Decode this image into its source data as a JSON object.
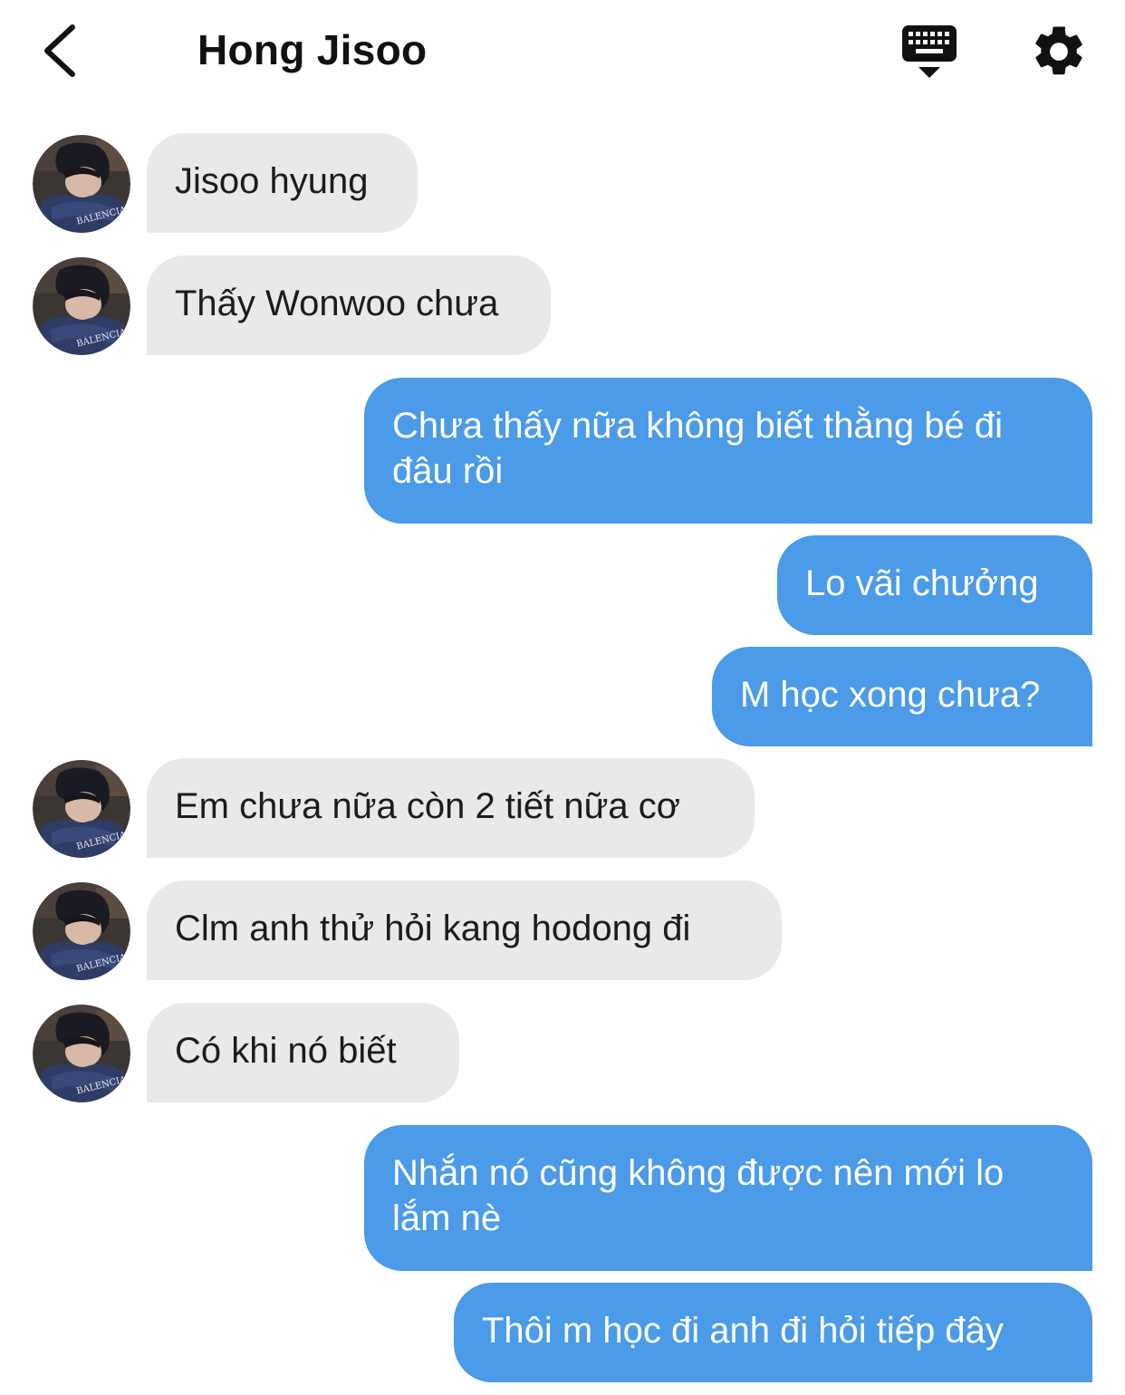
{
  "header": {
    "title": "Hong Jisoo",
    "back_icon": "chevron-left-icon",
    "keyboard_icon": "keyboard-hide-icon",
    "settings_icon": "gear-icon"
  },
  "colors": {
    "incoming_bubble": "#e9e9eb",
    "outgoing_bubble": "#4b9be8",
    "outgoing_text": "#ffffff",
    "incoming_text": "#1c1c1e"
  },
  "messages": [
    {
      "side": "in",
      "text": "Jisoo hyung"
    },
    {
      "side": "in",
      "text": "Thấy Wonwoo chưa"
    },
    {
      "side": "out",
      "text": "Chưa thấy nữa không biết thằng bé đi đâu rồi"
    },
    {
      "side": "out",
      "text": "Lo vãi chưởng"
    },
    {
      "side": "out",
      "text": "M học xong chưa?"
    },
    {
      "side": "in",
      "text": "Em chưa nữa còn 2 tiết nữa cơ"
    },
    {
      "side": "in",
      "text": "Clm anh thử hỏi kang hodong đi"
    },
    {
      "side": "in",
      "text": "Có khi nó biết"
    },
    {
      "side": "out",
      "text": "Nhắn nó cũng không được nên mới lo lắm nè"
    },
    {
      "side": "out",
      "text": "Thôi m học đi anh đi hỏi tiếp đây"
    }
  ]
}
